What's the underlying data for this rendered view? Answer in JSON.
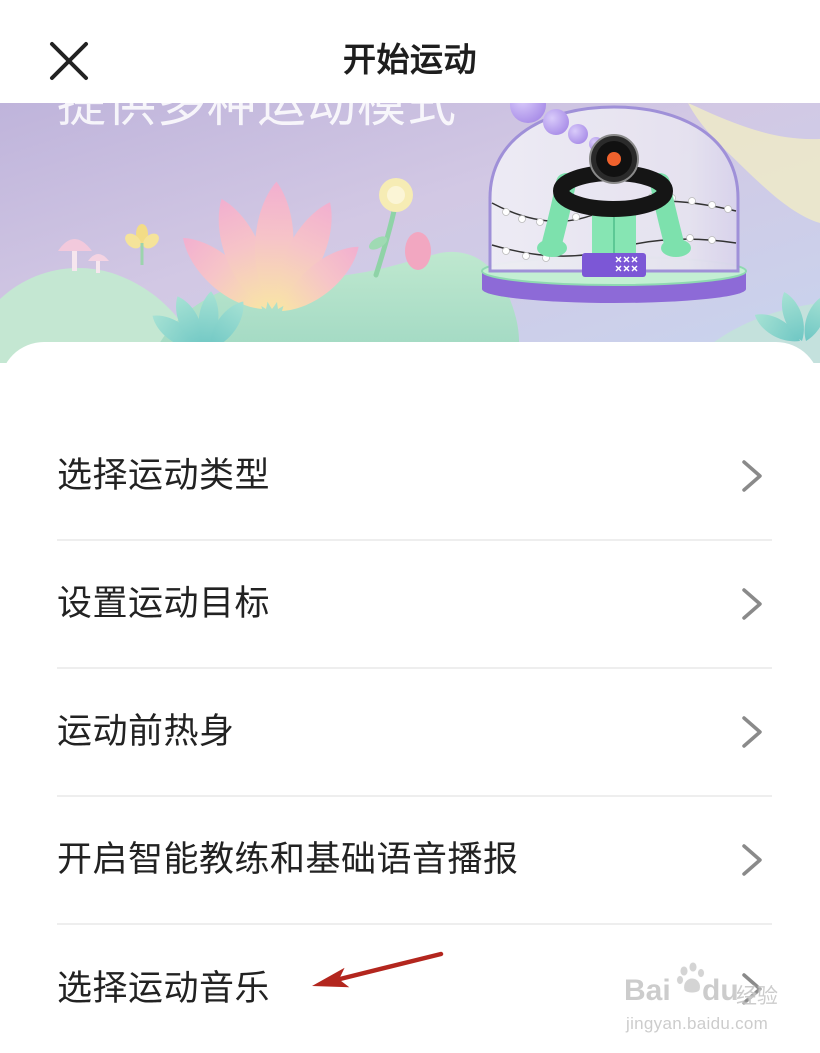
{
  "header": {
    "title": "开始运动",
    "close_icon": "close-icon"
  },
  "banner": {
    "slogan": "提供多种运动模式",
    "illustration": "smart-band-in-glass-dome"
  },
  "menu": {
    "items": [
      {
        "label": "选择运动类型",
        "icon": "chevron-right-icon"
      },
      {
        "label": "设置运动目标",
        "icon": "chevron-right-icon"
      },
      {
        "label": "运动前热身",
        "icon": "chevron-right-icon"
      },
      {
        "label": "开启智能教练和基础语音播报",
        "icon": "chevron-right-icon"
      },
      {
        "label": "选择运动音乐",
        "icon": "chevron-right-icon"
      }
    ]
  },
  "annotation": {
    "icon": "arrow-left-icon",
    "color": "#b3261e"
  },
  "watermark": {
    "brand": "Bai",
    "brand_suffix": "du",
    "product": "经验",
    "url": "jingyan.baidu.com",
    "icon": "paw-logo-icon"
  },
  "colors": {
    "background": "#ffffff",
    "text_primary": "#222222",
    "chevron": "#8a8a8a",
    "divider": "#eeeeee",
    "dome_outline": "#9e8ed8",
    "band_accent": "#f0622d"
  }
}
